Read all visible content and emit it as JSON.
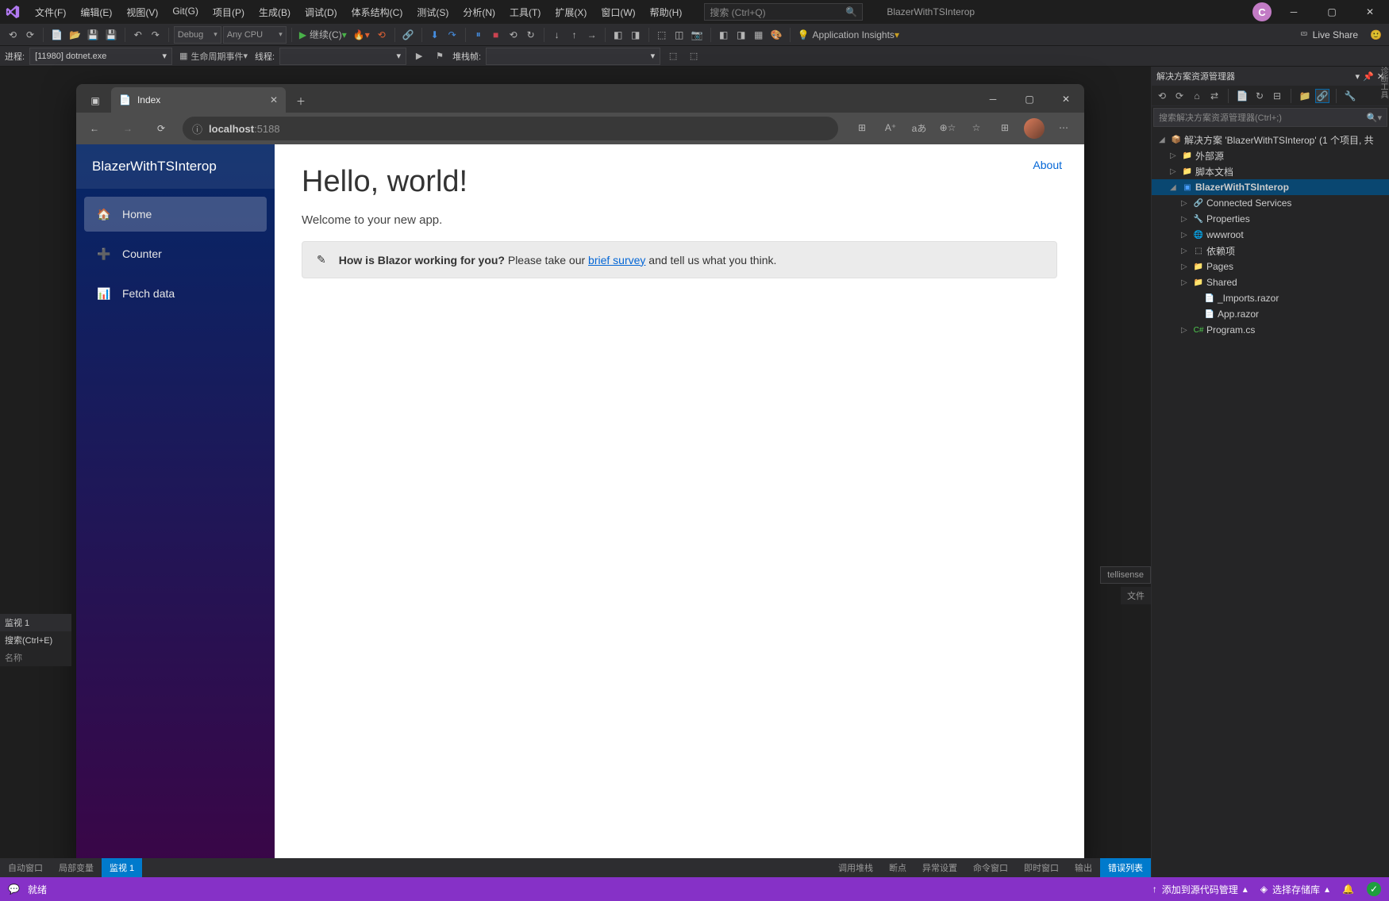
{
  "menu": {
    "file": "文件(F)",
    "edit": "编辑(E)",
    "view": "视图(V)",
    "git": "Git(G)",
    "project": "项目(P)",
    "build": "生成(B)",
    "debug": "调试(D)",
    "arch": "体系结构(C)",
    "test": "测试(S)",
    "analyze": "分析(N)",
    "tools": "工具(T)",
    "ext": "扩展(X)",
    "window": "窗口(W)",
    "help": "帮助(H)"
  },
  "search_placeholder": "搜索 (Ctrl+Q)",
  "app_title": "BlazerWithTSInterop",
  "avatar_initial": "C",
  "toolbar": {
    "config": "Debug",
    "platform": "Any CPU",
    "continue": "继续(C)",
    "app_insights": "Application Insights",
    "live_share": "Live Share"
  },
  "toolbar2": {
    "process_label": "进程:",
    "process_value": "[11980] dotnet.exe",
    "lifecycle": "生命周期事件",
    "thread": "线程:",
    "stack": "堆栈帧:"
  },
  "bottom_tabs": {
    "auto": "自动窗口",
    "locals": "局部变量",
    "watch": "监视 1",
    "callstack": "调用堆栈",
    "break": "断点",
    "except": "异常设置",
    "cmd": "命令窗口",
    "imm": "即时窗口",
    "output": "输出",
    "errors": "错误列表"
  },
  "watch_panel": {
    "title": "监视 1",
    "search": "搜索(Ctrl+E)",
    "col": "名称"
  },
  "intellisense": "tellisense",
  "file_label": "文件",
  "status": {
    "ready": "就绪",
    "add_src": "添加到源代码管理",
    "select_repo": "选择存储库"
  },
  "solution": {
    "panel_title": "解决方案资源管理器",
    "search": "搜索解决方案资源管理器(Ctrl+;)",
    "root": "解决方案 'BlazerWithTSInterop' (1 个项目, 共",
    "items": [
      "外部源",
      "脚本文档",
      "BlazerWithTSInterop",
      "Connected Services",
      "Properties",
      "wwwroot",
      "依赖项",
      "Pages",
      "Shared",
      "_Imports.razor",
      "App.razor",
      "Program.cs"
    ]
  },
  "browser": {
    "tab": "Index",
    "url_host": "localhost",
    "url_port": ":5188"
  },
  "page": {
    "brand": "BlazerWithTSInterop",
    "nav": {
      "home": "Home",
      "counter": "Counter",
      "fetch": "Fetch data"
    },
    "about": "About",
    "h1": "Hello, world!",
    "welcome": "Welcome to your new app.",
    "alert_strong": "How is Blazor working for you?",
    "alert_mid": " Please take our ",
    "alert_link": "brief survey",
    "alert_tail": " and tell us what you think."
  }
}
